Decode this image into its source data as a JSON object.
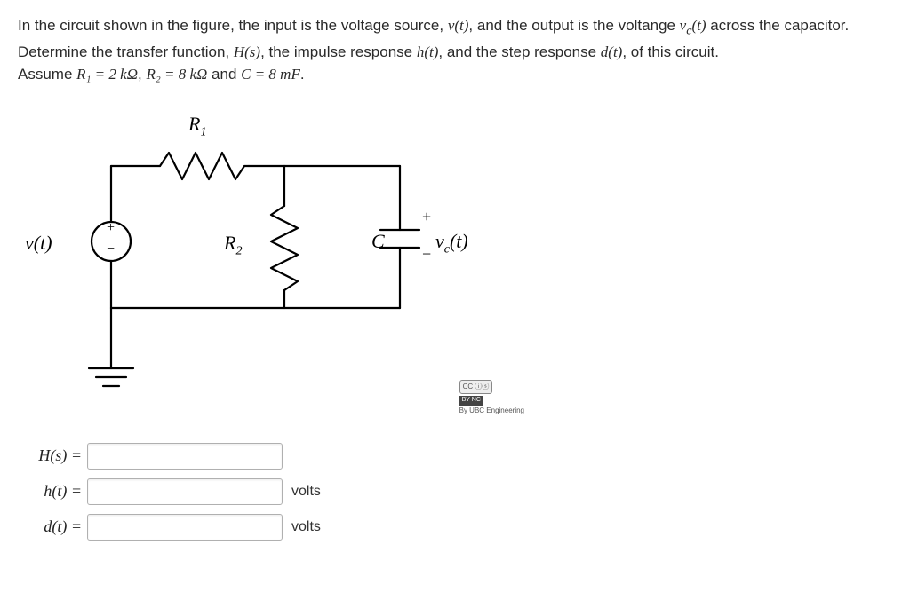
{
  "problem": {
    "sentence1_a": "In the circuit shown in the figure, the input is the voltage source, ",
    "vt": "v(t)",
    "sentence1_b": ", and the output is the voltange ",
    "vct": "v_c(t)",
    "sentence1_c": " across the capacitor. Determine the transfer function, ",
    "Hs": "H(s)",
    "sentence1_d": ", the impulse response ",
    "ht": "h(t)",
    "sentence1_e": ", and the step response ",
    "dt": "d(t)",
    "sentence1_f": ", of this circuit.",
    "sentence2_a": "Assume ",
    "R1_eq": "R₁ = 2 kΩ",
    "sep1": ", ",
    "R2_eq": "R₂ = 8 kΩ",
    "sentence2_b": " and ",
    "C_eq": "C = 8 mF",
    "sentence2_c": "."
  },
  "circuit": {
    "R1_label": "R",
    "R1_sub": "1",
    "R2_label": "R",
    "R2_sub": "2",
    "C_label": "C",
    "vt_label": "v(t)",
    "vct_label": "v",
    "vct_sub": "c",
    "vct_arg": "(t)",
    "plus": "+",
    "minus": "−"
  },
  "attribution": {
    "cc": "CC ⓘⓢ",
    "by_nc": "BY NC",
    "byline": "By UBC Engineering"
  },
  "answers": {
    "Hs": {
      "label": "H(s) =",
      "unit": ""
    },
    "ht": {
      "label": "h(t) =",
      "unit": "volts"
    },
    "dt": {
      "label": "d(t) =",
      "unit": "volts"
    }
  },
  "values": {
    "R1_ohms": 2000,
    "R2_ohms": 8000,
    "C_farads": 0.008
  }
}
